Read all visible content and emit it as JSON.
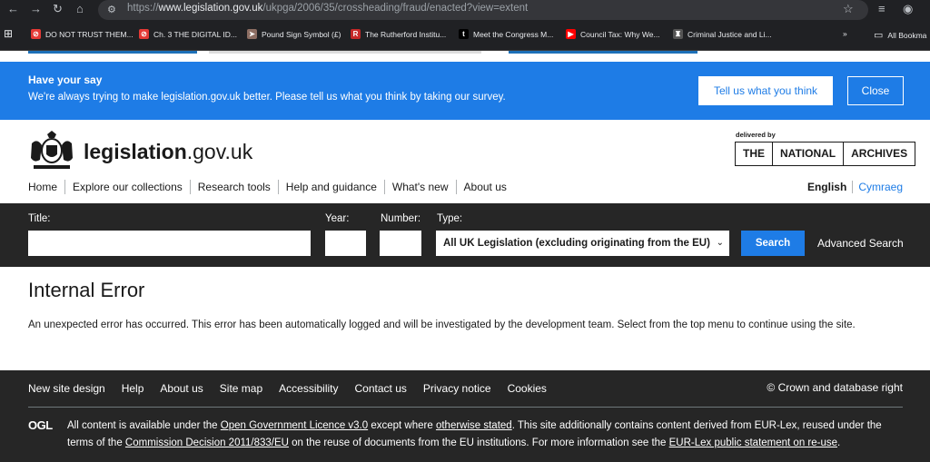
{
  "browser": {
    "url_prefix": "https://",
    "url_domain": "www.legislation.gov.uk",
    "url_path": "/ukpga/2006/35/crossheading/fraud/enacted?view=extent",
    "bookmarks": [
      {
        "label": "DO NOT TRUST THEM...",
        "icon": "no-entry-icon",
        "color": "#e53935"
      },
      {
        "label": "Ch. 3 THE DIGITAL ID...",
        "icon": "no-entry-icon",
        "color": "#e53935"
      },
      {
        "label": "Pound Sign Symbol (£)",
        "icon": "bird-icon",
        "color": "#8d6e63"
      },
      {
        "label": "The Rutherford Institu...",
        "icon": "r-logo-icon",
        "color": "#c62828"
      },
      {
        "label": "Meet the Congress M...",
        "icon": "t-logo-icon",
        "color": "#000000"
      },
      {
        "label": "Council Tax: Why We...",
        "icon": "youtube-icon",
        "color": "#ff0000"
      },
      {
        "label": "Criminal Justice and Li...",
        "icon": "crest-icon",
        "color": "#555555"
      }
    ],
    "all_bookmarks": "All Bookma"
  },
  "survey": {
    "title": "Have your say",
    "message": "We're always trying to make legislation.gov.uk better. Please tell us what you think by taking our survey.",
    "tell_button": "Tell us what you think",
    "close_button": "Close"
  },
  "header": {
    "site_name_bold": "legislation",
    "site_name_rest": ".gov.uk",
    "delivered_by": "delivered by",
    "tna": [
      "THE",
      "NATIONAL",
      "ARCHIVES"
    ],
    "nav": [
      "Home",
      "Explore our collections",
      "Research tools",
      "Help and guidance",
      "What's new",
      "About us"
    ],
    "lang_en": "English",
    "lang_cy": "Cymraeg"
  },
  "search": {
    "title_label": "Title:",
    "year_label": "Year:",
    "number_label": "Number:",
    "type_label": "Type:",
    "type_value": "All UK Legislation (excluding originating from the EU)",
    "search_button": "Search",
    "advanced_link": "Advanced Search"
  },
  "main": {
    "heading": "Internal Error",
    "message": "An unexpected error has occurred. This error has been automatically logged and will be investigated by the development team. Select from the top menu to continue using the site."
  },
  "footer": {
    "links": [
      "New site design",
      "Help",
      "About us",
      "Site map",
      "Accessibility",
      "Contact us",
      "Privacy notice",
      "Cookies"
    ],
    "copyright": "© Crown and database right",
    "ogl": "OGL",
    "lic_1": "All content is available under the ",
    "lic_link1": "Open Government Licence v3.0",
    "lic_2": " except where ",
    "lic_link2": "otherwise stated",
    "lic_3": ". This site additionally contains content derived from EUR-Lex, reused under the terms of the ",
    "lic_link3": "Commission Decision 2011/833/EU",
    "lic_4": " on the reuse of documents from the EU institutions. For more information see the ",
    "lic_link4": "EUR-Lex public statement on re-use",
    "lic_5": "."
  }
}
